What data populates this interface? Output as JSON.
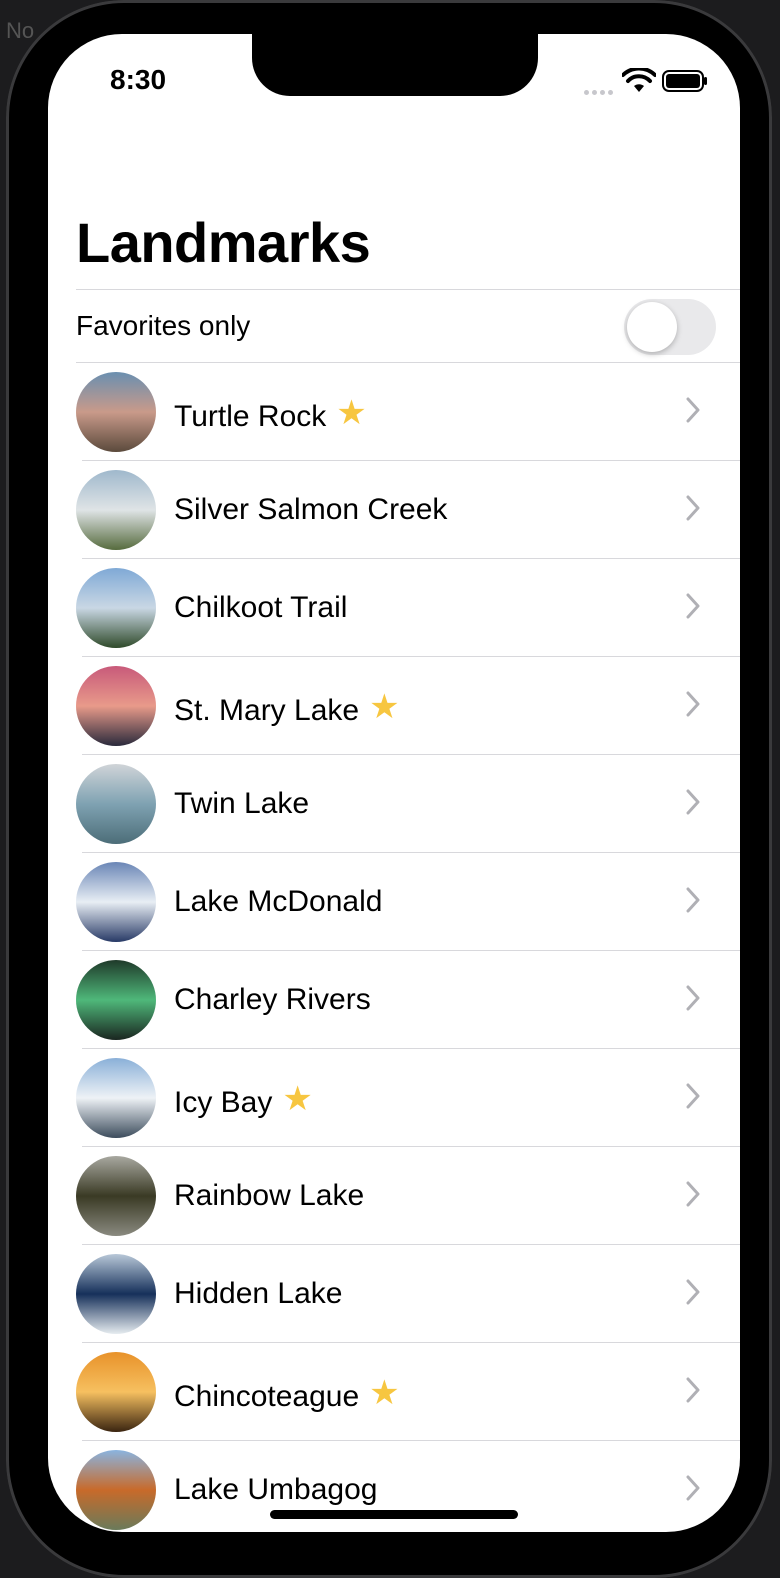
{
  "background": {
    "label": "No"
  },
  "status_bar": {
    "time": "8:30"
  },
  "nav": {
    "title": "Landmarks"
  },
  "filter": {
    "label": "Favorites only",
    "enabled": false
  },
  "colors": {
    "star": "#f7c640",
    "chevron": "#b0b0b5",
    "separator": "#d8d8dc"
  },
  "landmarks": [
    {
      "name": "Turtle Rock",
      "favorite": true,
      "thumb": [
        "#6a8fb0",
        "#c99a8a",
        "#5b4a3c"
      ]
    },
    {
      "name": "Silver Salmon Creek",
      "favorite": false,
      "thumb": [
        "#9fb8cc",
        "#dfe4e6",
        "#566b3e"
      ]
    },
    {
      "name": "Chilkoot Trail",
      "favorite": false,
      "thumb": [
        "#7fa9d6",
        "#c9d7e4",
        "#2f4a2a"
      ]
    },
    {
      "name": "St. Mary Lake",
      "favorite": true,
      "thumb": [
        "#c85a7a",
        "#e89a8a",
        "#2a2a3c"
      ]
    },
    {
      "name": "Twin Lake",
      "favorite": false,
      "thumb": [
        "#d0d4d8",
        "#7fa2b2",
        "#4c6d78"
      ]
    },
    {
      "name": "Lake McDonald",
      "favorite": false,
      "thumb": [
        "#6a86b6",
        "#e8eef4",
        "#283a66"
      ]
    },
    {
      "name": "Charley Rivers",
      "favorite": false,
      "thumb": [
        "#1f3a2a",
        "#4fb87a",
        "#1a2620"
      ]
    },
    {
      "name": "Icy Bay",
      "favorite": true,
      "thumb": [
        "#8ab0d8",
        "#eef2f6",
        "#3c4c5c"
      ]
    },
    {
      "name": "Rainbow Lake",
      "favorite": false,
      "thumb": [
        "#a8a8a0",
        "#3a3a24",
        "#8a8a80"
      ]
    },
    {
      "name": "Hidden Lake",
      "favorite": false,
      "thumb": [
        "#b8c8d8",
        "#16305a",
        "#e6ecf0"
      ]
    },
    {
      "name": "Chincoteague",
      "favorite": true,
      "thumb": [
        "#e8922a",
        "#f6c060",
        "#3a2410"
      ]
    },
    {
      "name": "Lake Umbagog",
      "favorite": false,
      "thumb": [
        "#8ab4e0",
        "#c86a2a",
        "#6a7a5a"
      ]
    }
  ]
}
